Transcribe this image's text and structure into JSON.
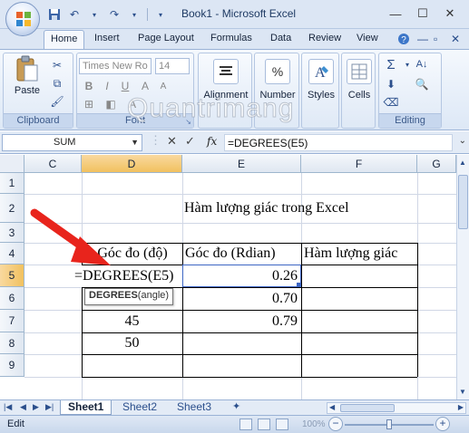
{
  "window": {
    "title": "Book1 - Microsoft Excel",
    "minimize": "—",
    "maximize": "☐",
    "close": "✕"
  },
  "quick_access": {
    "save_icon": "save-icon",
    "undo_icon": "undo-icon",
    "redo_icon": "redo-icon"
  },
  "ribbon": {
    "tabs": [
      "Home",
      "Insert",
      "Page Layout",
      "Formulas",
      "Data",
      "Review",
      "View"
    ],
    "clipboard": {
      "paste_label": "Paste",
      "group_label": "Clipboard"
    },
    "font": {
      "name_value": "Times New Ro",
      "size_value": "14",
      "group_label": "Font"
    },
    "alignment_label": "Alignment",
    "number_label": "Number",
    "styles_label": "Styles",
    "cells_label": "Cells",
    "editing_label": "Editing"
  },
  "formula_bar": {
    "name_box": "SUM",
    "fx": "fx",
    "formula": "=DEGREES(E5)"
  },
  "grid": {
    "columns": [
      "C",
      "D",
      "E",
      "F",
      "G"
    ],
    "active_column": "D",
    "rows": [
      "1",
      "2",
      "3",
      "4",
      "5",
      "6",
      "7",
      "8",
      "9"
    ],
    "active_row": "5",
    "title_cell": "Hàm lượng giác trong Excel",
    "headers": {
      "d4": "Góc đo (độ)",
      "e4": "Góc đo (Rdian)",
      "f4": "Hàm lượng giác"
    },
    "editing_cell": "=DEGREES(E5)",
    "e5": "0.26",
    "e6": "0.70",
    "d7": "45",
    "e7": "0.79",
    "d8": "50",
    "tooltip": {
      "func": "DEGREES",
      "args": "(angle)"
    }
  },
  "sheets": [
    "Sheet1",
    "Sheet2",
    "Sheet3"
  ],
  "active_sheet": "Sheet1",
  "status": {
    "mode": "Edit",
    "zoom": "100%"
  },
  "watermark": "Quantrimang"
}
